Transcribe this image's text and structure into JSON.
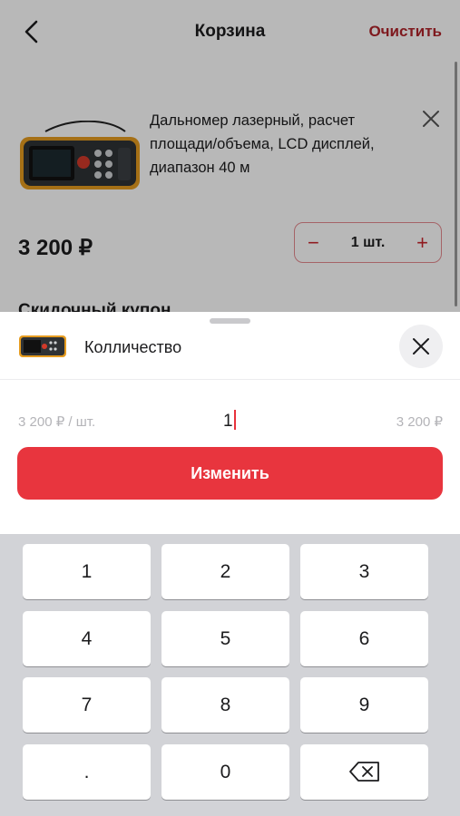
{
  "header": {
    "title": "Корзина",
    "clear_label": "Очистить"
  },
  "cart": {
    "product_title": "Дальномер лазерный, расчет площади/объема, LCD дисплей, диапазон 40 м",
    "price": "3 200 ₽",
    "quantity_label": "1 шт.",
    "minus_symbol": "−",
    "plus_symbol": "+",
    "coupon_title": "Скидочный купон"
  },
  "sheet": {
    "title": "Колличество",
    "unit_price": "3 200 ₽ / шт.",
    "quantity_value": "1",
    "total_price": "3 200 ₽",
    "submit_label": "Изменить"
  },
  "keypad": {
    "keys": [
      "1",
      "2",
      "3",
      "4",
      "5",
      "6",
      "7",
      "8",
      "9",
      ".",
      "0"
    ]
  },
  "colors": {
    "accent": "#e8353e",
    "clear_text": "#b0252b"
  }
}
